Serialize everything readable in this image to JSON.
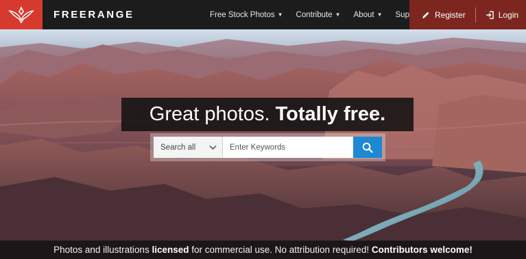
{
  "nav": {
    "brand": "FREERANGE",
    "menu": [
      {
        "label": "Free Stock Photos"
      },
      {
        "label": "Contribute"
      },
      {
        "label": "About"
      },
      {
        "label": "Support"
      }
    ],
    "register_label": "Register",
    "login_label": "Login"
  },
  "hero": {
    "headline_regular": "Great photos.",
    "headline_bold": "Totally free.",
    "search": {
      "select_value": "Search all",
      "placeholder": "Enter Keywords"
    },
    "banner": {
      "part1": "Photos and illustrations ",
      "bold1": "licensed",
      "part2": " for commercial use. No attribution required! ",
      "bold2": "Contributors welcome!"
    }
  },
  "colors": {
    "logo_red": "#d63a2f",
    "auth_bg": "#7d2620",
    "search_button": "#1d88d4"
  }
}
